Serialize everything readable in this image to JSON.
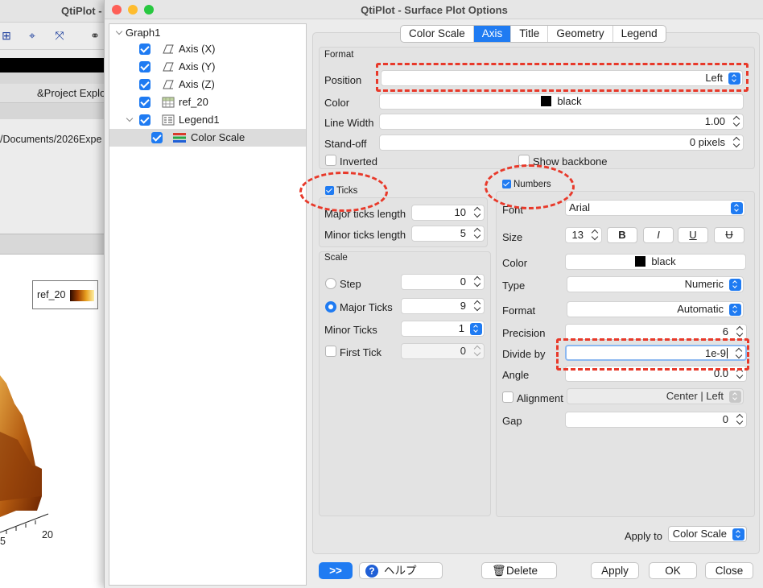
{
  "background": {
    "app_title": "QtiPlot -",
    "project_explorer_tab": "&Project Explo",
    "path_text": "/Documents/2026Expe",
    "legend_label": "ref_20",
    "axis_tick_5": "5",
    "axis_tick_20": "20"
  },
  "window": {
    "title": "QtiPlot - Surface Plot Options"
  },
  "tree": {
    "items": [
      {
        "label": "Graph1"
      },
      {
        "label": "Axis (X)"
      },
      {
        "label": "Axis (Y)"
      },
      {
        "label": "Axis (Z)"
      },
      {
        "label": "ref_20"
      },
      {
        "label": "Legend1"
      },
      {
        "label": "Color Scale"
      }
    ]
  },
  "tabs": [
    "Color Scale",
    "Axis",
    "Title",
    "Geometry",
    "Legend"
  ],
  "format": {
    "group_label": "Format",
    "position_label": "Position",
    "position_value": "Left",
    "color_label": "Color",
    "color_value": "black",
    "line_width_label": "Line Width",
    "line_width_value": "1.00",
    "standoff_label": "Stand-off",
    "standoff_value": "0 pixels",
    "inverted_label": "Inverted",
    "show_backbone_label": "Show backbone"
  },
  "ticks": {
    "group_label": "Ticks",
    "major_label": "Major ticks length",
    "major_value": "10",
    "minor_label": "Minor ticks length",
    "minor_value": "5"
  },
  "scale": {
    "group_label": "Scale",
    "step_label": "Step",
    "step_value": "0",
    "major_ticks_label": "Major Ticks",
    "major_ticks_value": "9",
    "minor_ticks_label": "Minor Ticks",
    "minor_ticks_value": "1",
    "first_tick_label": "First Tick",
    "first_tick_value": "0"
  },
  "numbers": {
    "group_label": "Numbers",
    "font_label": "Font",
    "font_value": "Arial",
    "size_label": "Size",
    "size_value": "13",
    "bold": "B",
    "italic": "I",
    "underline": "U",
    "strike": "U",
    "color_label": "Color",
    "color_value": "black",
    "type_label": "Type",
    "type_value": "Numeric",
    "format_label": "Format",
    "format_value": "Automatic",
    "precision_label": "Precision",
    "precision_value": "6",
    "divide_label": "Divide by",
    "divide_value": "1e-9",
    "angle_label": "Angle",
    "angle_value": "0.0",
    "alignment_label": "Alignment",
    "alignment_value": "Center | Left",
    "gap_label": "Gap",
    "gap_value": "0"
  },
  "apply_to": {
    "label": "Apply to",
    "value": "Color Scale"
  },
  "buttons": {
    "expand": ">>",
    "help": "ヘルプ",
    "delete": "Delete",
    "apply": "Apply",
    "ok": "OK",
    "close": "Close"
  },
  "colors": {
    "accent": "#1f7bf2",
    "highlight": "#e8392a"
  }
}
